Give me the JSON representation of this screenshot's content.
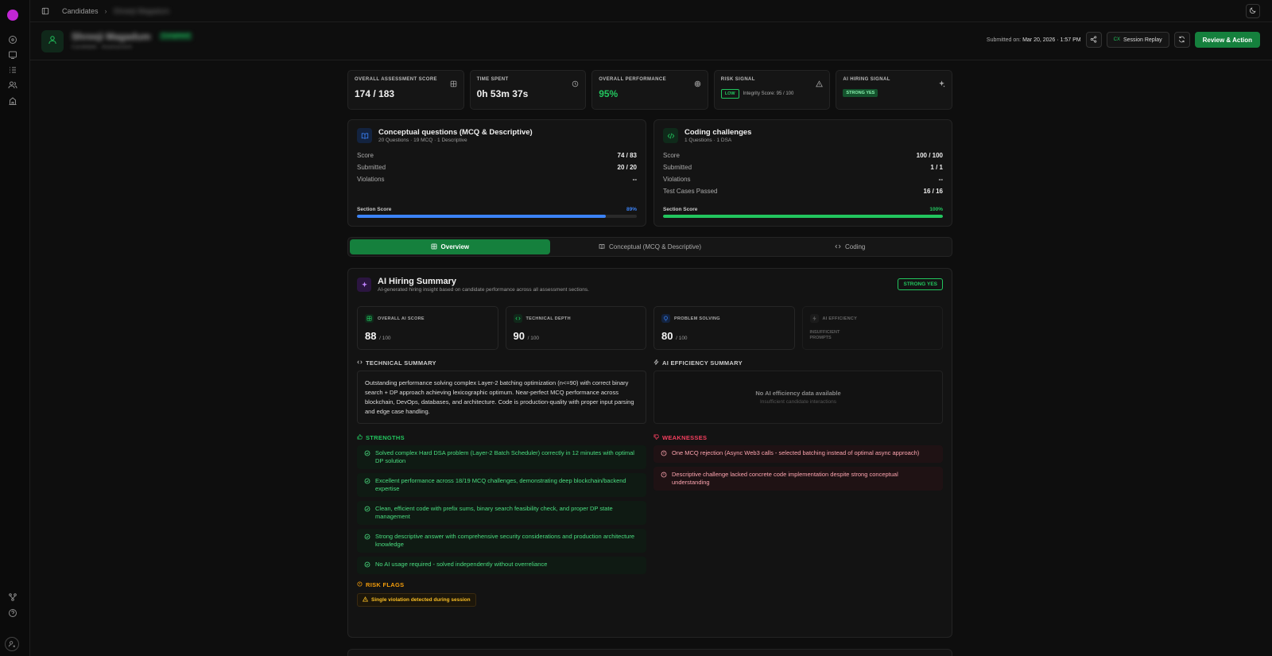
{
  "breadcrumb": {
    "root": "Candidates",
    "current": "Shreeji Magadum"
  },
  "candidate": {
    "name": "Shreeji Magadum",
    "badge": "Completed",
    "sub": "Candidate · Assessment"
  },
  "header": {
    "submitted_label": "Submitted on:",
    "submitted_value": "Mar 20, 2026 · 1:57 PM",
    "session_replay": "Session Replay",
    "cx_tag": "CX",
    "review_action": "Review & Action"
  },
  "metrics": {
    "score": {
      "label": "Overall Assessment Score",
      "value": "174 / 183"
    },
    "time": {
      "label": "Time Spent",
      "value": "0h 53m 37s"
    },
    "performance": {
      "label": "Overall Performance",
      "value": "95%"
    },
    "risk": {
      "label": "Risk Signal",
      "pill": "LOW",
      "detail": "Integrity Score: 95 / 100"
    },
    "hiring": {
      "label": "AI Hiring Signal",
      "pill": "STRONG YES"
    }
  },
  "conceptual": {
    "title": "Conceptual questions (MCQ & Descriptive)",
    "sub": "20 Questions · 19 MCQ · 1 Descriptive",
    "rows": [
      {
        "label": "Score",
        "value": "74 / 83"
      },
      {
        "label": "Submitted",
        "value": "20 / 20"
      },
      {
        "label": "Violations",
        "value": "--"
      }
    ],
    "bar_label": "Section Score",
    "bar_pct": "89%",
    "bar_value": 89
  },
  "coding": {
    "title": "Coding challenges",
    "sub": "1 Questions · 1 DSA",
    "rows": [
      {
        "label": "Score",
        "value": "100 / 100"
      },
      {
        "label": "Submitted",
        "value": "1 / 1"
      },
      {
        "label": "Violations",
        "value": "--"
      },
      {
        "label": "Test Cases Passed",
        "value": "16 / 16"
      }
    ],
    "bar_label": "Section Score",
    "bar_pct": "100%",
    "bar_value": 100
  },
  "tabs": [
    {
      "label": "Overview"
    },
    {
      "label": "Conceptual (MCQ & Descriptive)"
    },
    {
      "label": "Coding"
    }
  ],
  "summary": {
    "title": "AI Hiring Summary",
    "sub": "AI-generated hiring insight based on candidate performance across all assessment sections.",
    "badge": "STRONG YES",
    "ai_metrics": [
      {
        "label": "Overall AI Score",
        "value": "88",
        "out_of": "/ 100"
      },
      {
        "label": "Technical Depth",
        "value": "90",
        "out_of": "/ 100"
      },
      {
        "label": "Problem Solving",
        "value": "80",
        "out_of": "/ 100"
      },
      {
        "label": "AI Efficiency",
        "note": "Insufficient Prompts"
      }
    ],
    "technical_label": "Technical Summary",
    "technical_text": "Outstanding performance solving complex Layer-2 batching optimization (n<=90) with correct binary search + DP approach achieving lexicographic optimum. Near-perfect MCQ performance across blockchain, DevOps, databases, and architecture. Code is production-quality with proper input parsing and edge case handling.",
    "efficiency_label": "AI Efficiency Summary",
    "efficiency_empty": "No AI efficiency data available",
    "efficiency_empty_sub": "Insufficient candidate interactions",
    "strengths_label": "Strengths",
    "strengths": [
      "Solved complex Hard DSA problem (Layer-2 Batch Scheduler) correctly in 12 minutes with optimal DP solution",
      "Excellent performance across 18/19 MCQ challenges, demonstrating deep blockchain/backend expertise",
      "Clean, efficient code with prefix sums, binary search feasibility check, and proper DP state management",
      "Strong descriptive answer with comprehensive security considerations and production architecture knowledge",
      "No AI usage required - solved independently without overreliance"
    ],
    "weaknesses_label": "Weaknesses",
    "weaknesses": [
      "One MCQ rejection (Async Web3 calls - selected batching instead of optimal async approach)",
      "Descriptive challenge lacked concrete code implementation despite strong conceptual understanding"
    ],
    "risk_label": "Risk Flags",
    "risk_flag": "Single violation detected during session"
  },
  "colors": {
    "accent": "#15803d",
    "green": "#22c55e",
    "blue": "#3b82f6",
    "red": "#f43f5e",
    "orange": "#f59e0b"
  }
}
